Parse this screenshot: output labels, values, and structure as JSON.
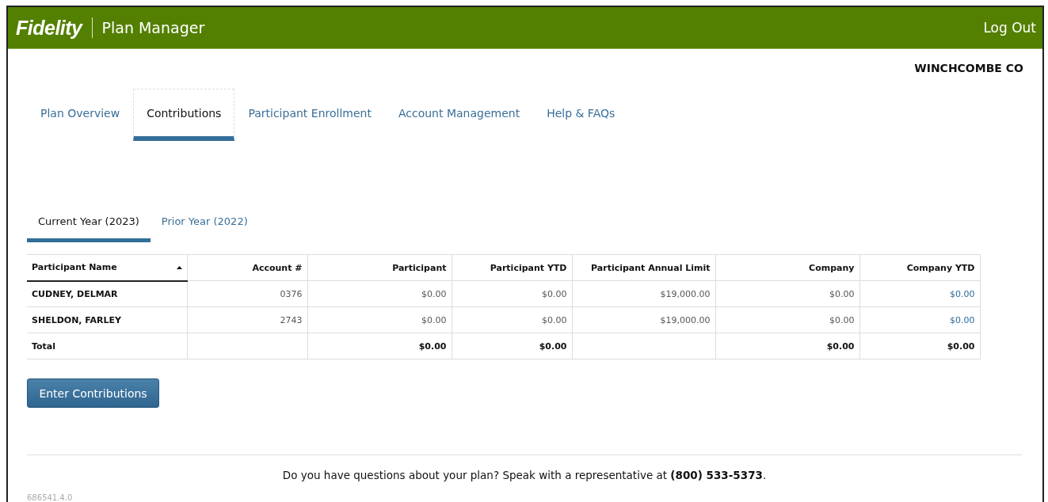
{
  "header": {
    "logo": "Fidelity",
    "title": "Plan Manager",
    "logout": "Log Out"
  },
  "company": "WINCHCOMBE CO",
  "tabs": [
    {
      "label": "Plan Overview",
      "selected": false
    },
    {
      "label": "Contributions",
      "selected": true
    },
    {
      "label": "Participant Enrollment",
      "selected": false
    },
    {
      "label": "Account Management",
      "selected": false
    },
    {
      "label": "Help & FAQs",
      "selected": false
    }
  ],
  "year_tabs": [
    {
      "label": "Current Year (2023)",
      "selected": true
    },
    {
      "label": "Prior Year (2022)",
      "selected": false
    }
  ],
  "table": {
    "columns": [
      {
        "label": "Participant Name",
        "sorted": true,
        "link": false
      },
      {
        "label": "Account #",
        "sorted": false,
        "link": false
      },
      {
        "label": "Participant",
        "sorted": false,
        "link": false
      },
      {
        "label": "Participant YTD",
        "sorted": false,
        "link": false
      },
      {
        "label": "Participant Annual Limit",
        "sorted": false,
        "link": false
      },
      {
        "label": "Company",
        "sorted": false,
        "link": false
      },
      {
        "label": "Company YTD",
        "sorted": false,
        "link": true
      }
    ],
    "rows": [
      {
        "cells": [
          "CUDNEY, DELMAR",
          "0376",
          "$0.00",
          "$0.00",
          "$19,000.00",
          "$0.00",
          "$0.00"
        ]
      },
      {
        "cells": [
          "SHELDON, FARLEY",
          "2743",
          "$0.00",
          "$0.00",
          "$19,000.00",
          "$0.00",
          "$0.00"
        ]
      }
    ],
    "total_row": {
      "cells": [
        "Total",
        null,
        "$0.00",
        "$0.00",
        null,
        "$0.00",
        "$0.00"
      ]
    }
  },
  "button": "Enter Contributions",
  "footer": {
    "text": "Do you have questions about your plan? Speak with a representative at **(800) 533-5373**."
  },
  "version": "686541.4.0"
}
